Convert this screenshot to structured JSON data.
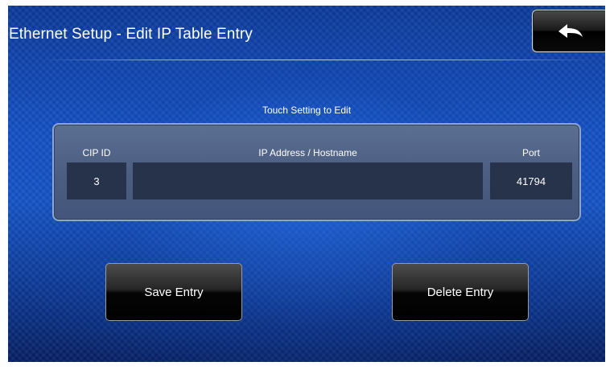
{
  "header": {
    "title": "Ethernet Setup - Edit IP Table Entry",
    "back_icon": "back-arrow-icon"
  },
  "main": {
    "hint": "Touch Setting to Edit",
    "table": {
      "columns": {
        "cip_id": "CIP ID",
        "ip_address": "IP Address / Hostname",
        "port": "Port"
      },
      "values": {
        "cip_id": "3",
        "ip_address": "",
        "port": "41794"
      }
    }
  },
  "actions": {
    "save_label": "Save Entry",
    "delete_label": "Delete Entry"
  },
  "colors": {
    "background": "#1450c4",
    "panel": "#4c5f82",
    "field": "#27324b",
    "button": "#000000"
  }
}
